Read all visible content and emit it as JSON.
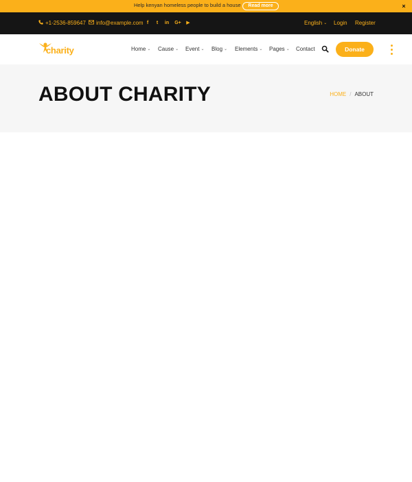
{
  "notice": {
    "message": "Help kenyan homeless people to build a house",
    "button_label": "Read more",
    "close_icon": "×"
  },
  "topbar": {
    "phone": "+1-2536-859647",
    "email": "info@example.com",
    "phone_icon": "phone-icon",
    "email_icon": "envelope-icon",
    "social": [
      {
        "name": "facebook-icon",
        "glyph": "f"
      },
      {
        "name": "twitter-icon",
        "glyph": "t"
      },
      {
        "name": "linkedin-icon",
        "glyph": "in"
      },
      {
        "name": "google-plus-icon",
        "glyph": "G+"
      },
      {
        "name": "youtube-icon",
        "glyph": "▶"
      }
    ],
    "language": "English",
    "login": "Login",
    "register": "Register"
  },
  "header": {
    "logo_text": "charity",
    "nav": {
      "home": "Home",
      "cause": "Cause",
      "event": "Event",
      "blog": "Blog",
      "elements": "Elements",
      "pages": "Pages",
      "contact": "Contact"
    },
    "donate_label": "Donate"
  },
  "banner": {
    "title": "ABOUT CHARITY",
    "breadcrumb": {
      "home": "HOME",
      "separator": "/",
      "current": "ABOUT"
    }
  },
  "colors": {
    "accent": "#fbb01a",
    "topbar_bg": "#151515",
    "banner_bg": "#f6f6f6",
    "title": "#111111"
  }
}
